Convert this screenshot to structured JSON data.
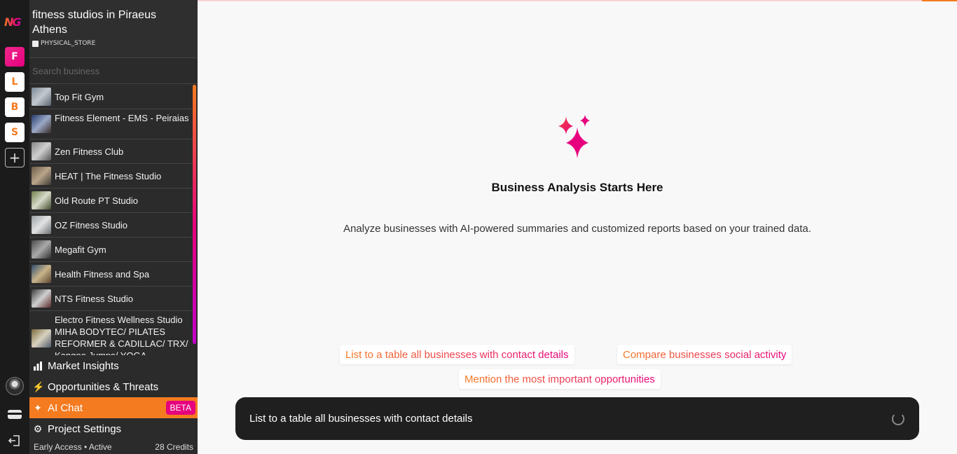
{
  "app": {
    "logo_text": "NG"
  },
  "rail": {
    "projects": [
      {
        "letter": "F",
        "active": true
      },
      {
        "letter": "L",
        "active": false
      },
      {
        "letter": "B",
        "active": false
      },
      {
        "letter": "S",
        "active": false
      }
    ],
    "add_label": "+"
  },
  "project": {
    "title": "fitness studios in Piraeus Athens",
    "type": "PHYSICAL_STORE"
  },
  "search": {
    "placeholder": "Search business"
  },
  "businesses": [
    {
      "name": "Top Fit Gym"
    },
    {
      "name": "Fitness Element - EMS - Peiraias"
    },
    {
      "name": "Zen Fitness Club"
    },
    {
      "name": "HEAT | The Fitness Studio"
    },
    {
      "name": "Old Route PT Studio"
    },
    {
      "name": "OZ Fitness Studio"
    },
    {
      "name": "Megafit Gym"
    },
    {
      "name": "Health Fitness and Spa"
    },
    {
      "name": "NTS Fitness Studio"
    },
    {
      "name": "Electro Fitness Wellness Studio MIHA BODYTEC/ PILATES REFORMER & CADILLAC/ TRX/ Kangoo Jumps/ YOGA"
    }
  ],
  "menu": {
    "market_insights": "Market Insights",
    "opportunities": "Opportunities & Threats",
    "ai_chat": "AI Chat",
    "ai_chat_badge": "BETA",
    "settings": "Project Settings"
  },
  "footer": {
    "status": "Early Access • Active",
    "credits": "28 Credits"
  },
  "main": {
    "title": "Business Analysis Starts Here",
    "subtitle": "Analyze businesses with AI-powered summaries and customized reports based on your trained data.",
    "suggestions": [
      "List to a table all businesses with contact details",
      "Compare businesses social activity",
      "Mention the most important opportunities"
    ],
    "chat_value": "List to a table all businesses with contact details"
  },
  "colors": {
    "accent_orange": "#f47b20",
    "accent_pink": "#e6007e",
    "sidebar_bg": "#2b2b2b",
    "rail_bg": "#1b1b1b"
  }
}
